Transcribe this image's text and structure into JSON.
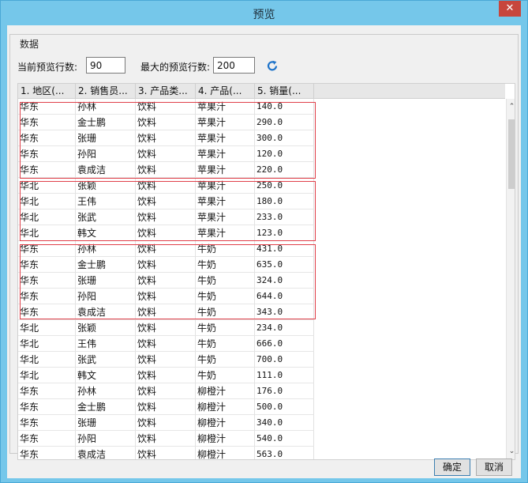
{
  "window": {
    "title": "预览",
    "close_glyph": "✕"
  },
  "group": {
    "label": "数据"
  },
  "options": {
    "current_rows_label": "当前预览行数:",
    "current_rows_value": "90",
    "max_rows_label": "最大的预览行数:",
    "max_rows_value": "200",
    "refresh_icon": "refresh-icon",
    "accent": "#1e73c9"
  },
  "table": {
    "columns": [
      "1. 地区(...",
      "2. 销售员...",
      "3. 产品类...",
      "4. 产品(...",
      "5. 销量(..."
    ],
    "rows": [
      [
        "华东",
        "孙林",
        "饮料",
        "苹果汁",
        "140.0"
      ],
      [
        "华东",
        "金士鹏",
        "饮料",
        "苹果汁",
        "290.0"
      ],
      [
        "华东",
        "张珊",
        "饮料",
        "苹果汁",
        "300.0"
      ],
      [
        "华东",
        "孙阳",
        "饮料",
        "苹果汁",
        "120.0"
      ],
      [
        "华东",
        "袁成洁",
        "饮料",
        "苹果汁",
        "220.0"
      ],
      [
        "华北",
        "张颖",
        "饮料",
        "苹果汁",
        "250.0"
      ],
      [
        "华北",
        "王伟",
        "饮料",
        "苹果汁",
        "180.0"
      ],
      [
        "华北",
        "张武",
        "饮料",
        "苹果汁",
        "233.0"
      ],
      [
        "华北",
        "韩文",
        "饮料",
        "苹果汁",
        "123.0"
      ],
      [
        "华东",
        "孙林",
        "饮料",
        "牛奶",
        "431.0"
      ],
      [
        "华东",
        "金士鹏",
        "饮料",
        "牛奶",
        "635.0"
      ],
      [
        "华东",
        "张珊",
        "饮料",
        "牛奶",
        "324.0"
      ],
      [
        "华东",
        "孙阳",
        "饮料",
        "牛奶",
        "644.0"
      ],
      [
        "华东",
        "袁成洁",
        "饮料",
        "牛奶",
        "343.0"
      ],
      [
        "华北",
        "张颖",
        "饮料",
        "牛奶",
        "234.0"
      ],
      [
        "华北",
        "王伟",
        "饮料",
        "牛奶",
        "666.0"
      ],
      [
        "华北",
        "张武",
        "饮料",
        "牛奶",
        "700.0"
      ],
      [
        "华北",
        "韩文",
        "饮料",
        "牛奶",
        "111.0"
      ],
      [
        "华东",
        "孙林",
        "饮料",
        "柳橙汁",
        "176.0"
      ],
      [
        "华东",
        "金士鹏",
        "饮料",
        "柳橙汁",
        "500.0"
      ],
      [
        "华东",
        "张珊",
        "饮料",
        "柳橙汁",
        "340.0"
      ],
      [
        "华东",
        "孙阳",
        "饮料",
        "柳橙汁",
        "540.0"
      ],
      [
        "华东",
        "袁成洁",
        "饮料",
        "柳橙汁",
        "563.0"
      ]
    ],
    "highlight_color": "#e0404a"
  },
  "scrollbar": {
    "up_glyph": "⌃",
    "down_glyph": "⌄"
  },
  "buttons": {
    "ok": "确定",
    "cancel": "取消"
  }
}
